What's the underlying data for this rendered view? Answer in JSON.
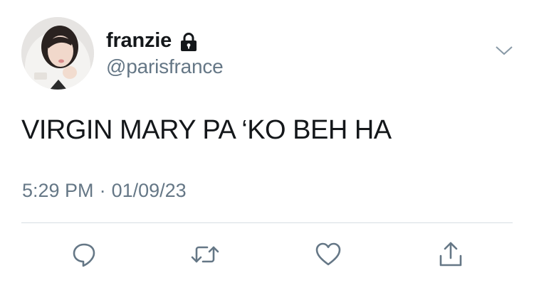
{
  "user": {
    "display_name": "franzie",
    "handle": "@parisfrance",
    "protected": true,
    "avatar_icon": "profile-photo"
  },
  "tweet": {
    "text": "VIRGIN MARY PA ‘KO BEH HA",
    "time": "5:29 PM",
    "separator": "·",
    "date": "01/09/23"
  },
  "actions": [
    {
      "name": "reply",
      "icon": "reply-icon"
    },
    {
      "name": "retweet",
      "icon": "retweet-icon"
    },
    {
      "name": "like",
      "icon": "heart-icon"
    },
    {
      "name": "share",
      "icon": "share-icon"
    }
  ],
  "colors": {
    "text": "#14171a",
    "secondary": "#657786",
    "icon": "#657786",
    "divider": "#d6dde3"
  }
}
